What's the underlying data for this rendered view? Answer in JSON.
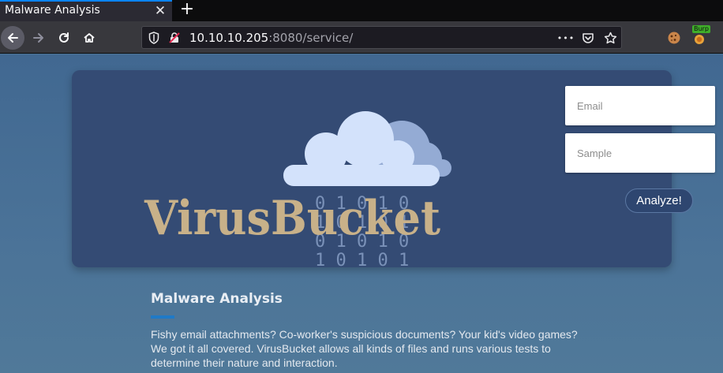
{
  "browser": {
    "tab_title": "Malware Analysis",
    "tab_close": "✕",
    "new_tab": "+",
    "url_host": "10.10.10.205",
    "url_rest": ":8080/service/",
    "menu_dots": "•••",
    "burp_label": "Burp"
  },
  "hero": {
    "brand": "VirusBucket",
    "binary_rows": [
      "0 1 0 1 0",
      "1 0 1 0 1",
      "0 1 0 1 0",
      "1 0 1 0 1"
    ]
  },
  "form": {
    "email_placeholder": "Email",
    "sample_placeholder": "Sample",
    "submit_label": "Analyze!"
  },
  "about": {
    "title": "Malware Analysis",
    "body": "Fishy email attachments? Co-worker's suspicious documents? Your kid's video games? We got it all covered. VirusBucket allows all kinds of files and runs various tests to determine their nature and interaction."
  },
  "colors": {
    "page_bg": "#4a7294",
    "hero_bg": "#344b74",
    "brand_text": "#c8b189",
    "accent": "#1f7ac7"
  }
}
